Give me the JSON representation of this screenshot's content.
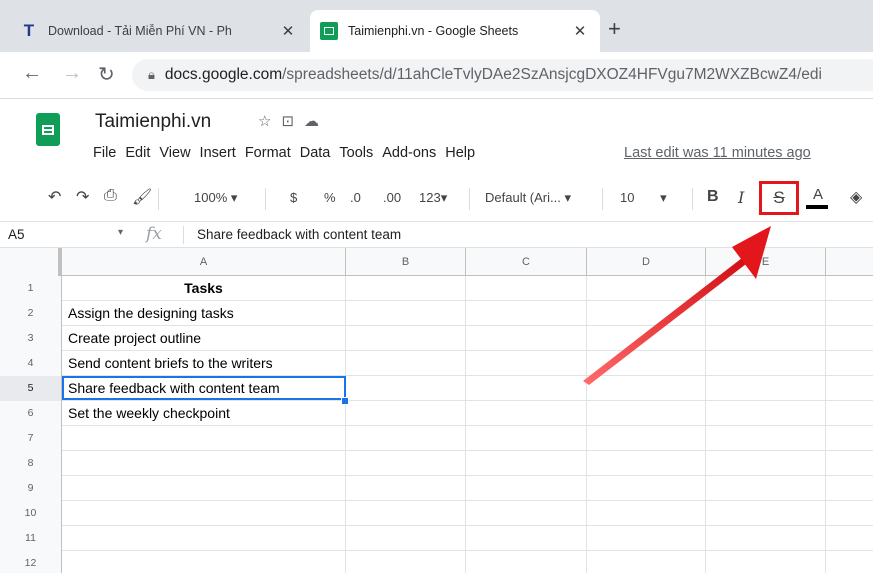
{
  "browser": {
    "tabs": [
      {
        "title": "Download - Tải Miễn Phí VN - Ph",
        "favicon": "T",
        "active": false
      },
      {
        "title": "Taimienphi.vn - Google Sheets",
        "favicon": "sheets",
        "active": true
      }
    ],
    "new_tab_symbol": "+",
    "close_symbol": "✕",
    "url_host": "docs.google.com",
    "url_path": "/spreadsheets/d/11ahCleTvlyDAe2SzAnsjcgDXOZ4HFVgu7M2WXZBcwZ4/edi"
  },
  "doc": {
    "title": "Taimienphi.vn",
    "menu": [
      "File",
      "Edit",
      "View",
      "Insert",
      "Format",
      "Data",
      "Tools",
      "Add-ons",
      "Help"
    ],
    "last_edit": "Last edit was 11 minutes ago"
  },
  "toolbar": {
    "zoom": "100%",
    "currency": "$",
    "percent": "%",
    "decrease_decimal": ".0",
    "increase_decimal": ".00",
    "more_formats": "123",
    "font": "Default (Ari...",
    "font_size": "10",
    "bold": "B",
    "italic": "I",
    "strikethrough": "S",
    "text_color": "A"
  },
  "formula_bar": {
    "cell_ref": "A5",
    "fx": "fx",
    "content": "Share feedback with content team"
  },
  "grid": {
    "columns": [
      "A",
      "B",
      "C",
      "D",
      "E"
    ],
    "rows": [
      {
        "num": "1",
        "a": "Tasks"
      },
      {
        "num": "2",
        "a": "Assign the designing tasks"
      },
      {
        "num": "3",
        "a": "Create project outline"
      },
      {
        "num": "4",
        "a": "Send content briefs to the writers"
      },
      {
        "num": "5",
        "a": "Share feedback with content team"
      },
      {
        "num": "6",
        "a": "Set the weekly checkpoint"
      },
      {
        "num": "7",
        "a": ""
      },
      {
        "num": "8",
        "a": ""
      },
      {
        "num": "9",
        "a": ""
      },
      {
        "num": "10",
        "a": ""
      },
      {
        "num": "11",
        "a": ""
      },
      {
        "num": "12",
        "a": ""
      }
    ]
  },
  "colors": {
    "highlight_box": "#e3161b",
    "arrow": "#e3161b",
    "selection": "#1a73e8",
    "sheets_green": "#0f9d58"
  }
}
